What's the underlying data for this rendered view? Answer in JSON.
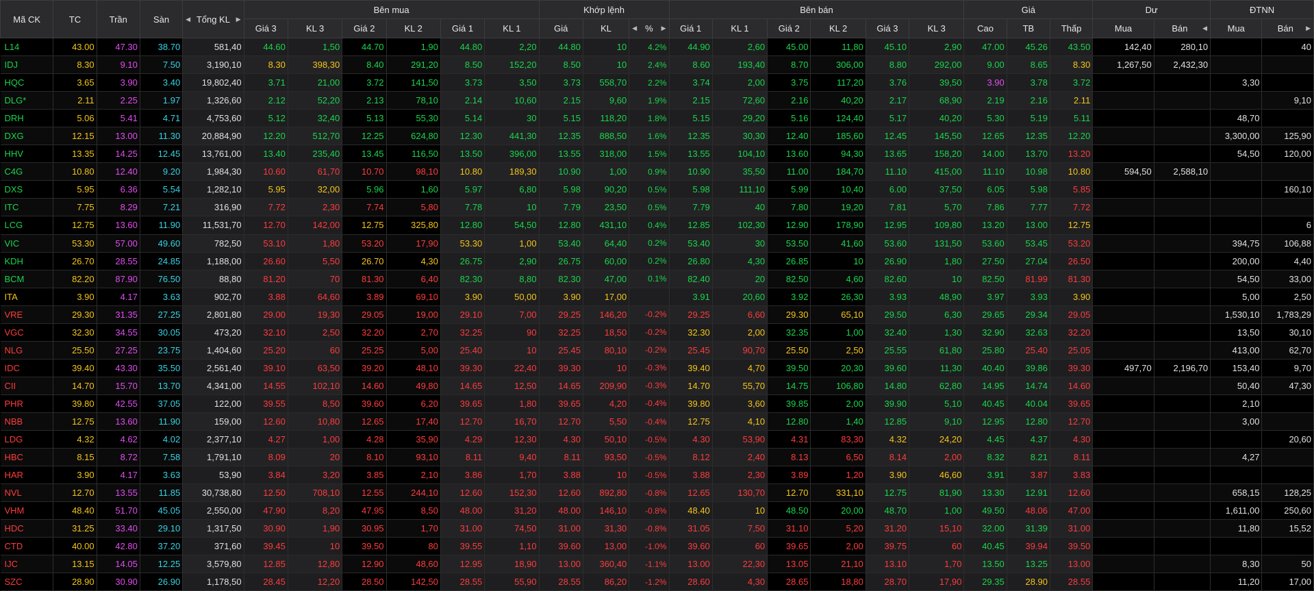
{
  "headers": {
    "symbol": "Mã CK",
    "ref": "TC",
    "ceil": "Trần",
    "floor": "Sàn",
    "total": "Tổng KL",
    "buy": "Bên mua",
    "match": "Khớp lệnh",
    "sell": "Bên bán",
    "price": "Giá",
    "remain": "Dư",
    "foreign": "ĐTNN",
    "price3": "Giá 3",
    "vol3": "KL 3",
    "price2": "Giá 2",
    "vol2": "KL 2",
    "price1": "Giá 1",
    "vol1": "KL 1",
    "matchPrice": "Giá",
    "matchVol": "KL",
    "pct": "%",
    "high": "Cao",
    "avg": "TB",
    "low": "Thấp",
    "remBuy": "Mua",
    "remSell": "Bán",
    "fBuy": "Mua",
    "fSell": "Bán"
  },
  "colors": {
    "up": "#19d54a",
    "down": "#ff3b3b",
    "ref": "#f5c518",
    "ceil": "#e34cf2",
    "floor": "#35d3e6"
  },
  "rows": [
    [
      "L14",
      "43.00",
      "47.30",
      "38.70",
      "581,40",
      "44.60",
      "1,50",
      "44.70",
      "1,90",
      "44.80",
      "2,20",
      "44.80",
      "10",
      "4.2%",
      "44.90",
      "2,60",
      "45.00",
      "11,80",
      "45.10",
      "2,90",
      "47.00",
      "45.26",
      "43.50",
      "142,40",
      "280,10",
      "",
      "40"
    ],
    [
      "IDJ",
      "8.30",
      "9.10",
      "7.50",
      "3,190,10",
      "8.30",
      "398,30",
      "8.40",
      "291,20",
      "8.50",
      "152,20",
      "8.50",
      "10",
      "2.4%",
      "8.60",
      "193,40",
      "8.70",
      "306,00",
      "8.80",
      "292,00",
      "9.00",
      "8.65",
      "8.30",
      "1,267,50",
      "2,432,30",
      "",
      ""
    ],
    [
      "HQC",
      "3.65",
      "3.90",
      "3.40",
      "19,802,40",
      "3.71",
      "21,00",
      "3.72",
      "141,50",
      "3.73",
      "3,50",
      "3.73",
      "558,70",
      "2.2%",
      "3.74",
      "2,00",
      "3.75",
      "117,20",
      "3.76",
      "39,50",
      "3.90",
      "3.78",
      "3.72",
      "",
      "",
      "3,30",
      ""
    ],
    [
      "DLG*",
      "2.11",
      "2.25",
      "1.97",
      "1,326,60",
      "2.12",
      "52,20",
      "2.13",
      "78,10",
      "2.14",
      "10,60",
      "2.15",
      "9,60",
      "1.9%",
      "2.15",
      "72,60",
      "2.16",
      "40,20",
      "2.17",
      "68,90",
      "2.19",
      "2.16",
      "2.11",
      "",
      "",
      "",
      "9,10"
    ],
    [
      "DRH",
      "5.06",
      "5.41",
      "4.71",
      "4,753,60",
      "5.12",
      "32,40",
      "5.13",
      "55,30",
      "5.14",
      "30",
      "5.15",
      "118,20",
      "1.8%",
      "5.15",
      "29,20",
      "5.16",
      "124,40",
      "5.17",
      "40,20",
      "5.30",
      "5.19",
      "5.11",
      "",
      "",
      "48,70",
      ""
    ],
    [
      "DXG",
      "12.15",
      "13.00",
      "11.30",
      "20,884,90",
      "12.20",
      "512,70",
      "12.25",
      "624,80",
      "12.30",
      "441,30",
      "12.35",
      "888,50",
      "1.6%",
      "12.35",
      "30,30",
      "12.40",
      "185,60",
      "12.45",
      "145,50",
      "12.65",
      "12.35",
      "12.20",
      "",
      "",
      "3,300,00",
      "125,90"
    ],
    [
      "HHV",
      "13.35",
      "14.25",
      "12.45",
      "13,761,00",
      "13.40",
      "235,40",
      "13.45",
      "116,50",
      "13.50",
      "396,00",
      "13.55",
      "318,00",
      "1.5%",
      "13.55",
      "104,10",
      "13.60",
      "94,30",
      "13.65",
      "158,20",
      "14.00",
      "13.70",
      "13.20",
      "",
      "",
      "54,50",
      "120,00"
    ],
    [
      "C4G",
      "10.80",
      "12.40",
      "9.20",
      "1,984,30",
      "10.60",
      "61,70",
      "10.70",
      "98,10",
      "10.80",
      "189,30",
      "10.90",
      "1,00",
      "0.9%",
      "10.90",
      "35,50",
      "11.00",
      "184,70",
      "11.10",
      "415,00",
      "11.10",
      "10.98",
      "10.80",
      "594,50",
      "2,588,10",
      "",
      ""
    ],
    [
      "DXS",
      "5.95",
      "6.36",
      "5.54",
      "1,282,10",
      "5.95",
      "32,00",
      "5.96",
      "1,60",
      "5.97",
      "6,80",
      "5.98",
      "90,20",
      "0.5%",
      "5.98",
      "111,10",
      "5.99",
      "10,40",
      "6.00",
      "37,50",
      "6.05",
      "5.98",
      "5.85",
      "",
      "",
      "",
      "160,10"
    ],
    [
      "ITC",
      "7.75",
      "8.29",
      "7.21",
      "316,90",
      "7.72",
      "2,30",
      "7.74",
      "5,80",
      "7.78",
      "10",
      "7.79",
      "23,50",
      "0.5%",
      "7.79",
      "40",
      "7.80",
      "19,20",
      "7.81",
      "5,70",
      "7.86",
      "7.77",
      "7.72",
      "",
      "",
      "",
      ""
    ],
    [
      "LCG",
      "12.75",
      "13.60",
      "11.90",
      "11,531,70",
      "12.70",
      "142,00",
      "12.75",
      "325,80",
      "12.80",
      "54,50",
      "12.80",
      "431,10",
      "0.4%",
      "12.85",
      "102,30",
      "12.90",
      "178,90",
      "12.95",
      "109,80",
      "13.20",
      "13.00",
      "12.75",
      "",
      "",
      "",
      "6"
    ],
    [
      "VIC",
      "53.30",
      "57.00",
      "49.60",
      "782,50",
      "53.10",
      "1,80",
      "53.20",
      "17,90",
      "53.30",
      "1,00",
      "53.40",
      "64,40",
      "0.2%",
      "53.40",
      "30",
      "53.50",
      "41,60",
      "53.60",
      "131,50",
      "53.60",
      "53.45",
      "53.20",
      "",
      "",
      "394,75",
      "106,88"
    ],
    [
      "KDH",
      "26.70",
      "28.55",
      "24.85",
      "1,188,00",
      "26.60",
      "5,50",
      "26.70",
      "4,30",
      "26.75",
      "2,90",
      "26.75",
      "60,00",
      "0.2%",
      "26.80",
      "4,30",
      "26.85",
      "10",
      "26.90",
      "1,80",
      "27.50",
      "27.04",
      "26.50",
      "",
      "",
      "200,00",
      "4,40"
    ],
    [
      "BCM",
      "82.20",
      "87.90",
      "76.50",
      "88,80",
      "81.20",
      "70",
      "81.30",
      "6,40",
      "82.30",
      "8,80",
      "82.30",
      "47,00",
      "0.1%",
      "82.40",
      "20",
      "82.50",
      "4,60",
      "82.60",
      "10",
      "82.50",
      "81.99",
      "81.30",
      "",
      "",
      "54,50",
      "33,00"
    ],
    [
      "ITA",
      "3.90",
      "4.17",
      "3.63",
      "902,70",
      "3.88",
      "64,60",
      "3.89",
      "69,10",
      "3.90",
      "50,00",
      "3.90",
      "17,00",
      "",
      "3.91",
      "20,60",
      "3.92",
      "26,30",
      "3.93",
      "48,90",
      "3.97",
      "3.93",
      "3.90",
      "",
      "",
      "5,00",
      "2,50"
    ],
    [
      "VRE",
      "29.30",
      "31.35",
      "27.25",
      "2,801,80",
      "29.00",
      "19,30",
      "29.05",
      "19,00",
      "29.10",
      "7,00",
      "29.25",
      "146,20",
      "-0.2%",
      "29.25",
      "6,60",
      "29.30",
      "65,10",
      "29.50",
      "6,30",
      "29.65",
      "29.34",
      "29.05",
      "",
      "",
      "1,530,10",
      "1,783,29"
    ],
    [
      "VGC",
      "32.30",
      "34.55",
      "30.05",
      "473,20",
      "32.10",
      "2,50",
      "32.20",
      "2,70",
      "32.25",
      "90",
      "32.25",
      "18,50",
      "-0.2%",
      "32.30",
      "2,00",
      "32.35",
      "1,00",
      "32.40",
      "1,30",
      "32.90",
      "32.63",
      "32.20",
      "",
      "",
      "13,50",
      "30,10"
    ],
    [
      "NLG",
      "25.50",
      "27.25",
      "23.75",
      "1,404,60",
      "25.20",
      "60",
      "25.25",
      "5,00",
      "25.40",
      "10",
      "25.45",
      "80,10",
      "-0.2%",
      "25.45",
      "90,70",
      "25.50",
      "2,50",
      "25.55",
      "61,80",
      "25.80",
      "25.40",
      "25.05",
      "",
      "",
      "413,00",
      "62,70"
    ],
    [
      "IDC",
      "39.40",
      "43.30",
      "35.50",
      "2,561,40",
      "39.10",
      "63,50",
      "39.20",
      "48,10",
      "39.30",
      "22,40",
      "39.30",
      "10",
      "-0.3%",
      "39.40",
      "4,70",
      "39.50",
      "20,30",
      "39.60",
      "11,30",
      "40.40",
      "39.86",
      "39.30",
      "497,70",
      "2,196,70",
      "153,40",
      "9,70"
    ],
    [
      "CII",
      "14.70",
      "15.70",
      "13.70",
      "4,341,00",
      "14.55",
      "102,10",
      "14.60",
      "49,80",
      "14.65",
      "12,50",
      "14.65",
      "209,90",
      "-0.3%",
      "14.70",
      "55,70",
      "14.75",
      "106,80",
      "14.80",
      "62,80",
      "14.95",
      "14.74",
      "14.60",
      "",
      "",
      "50,40",
      "47,30"
    ],
    [
      "PHR",
      "39.80",
      "42.55",
      "37.05",
      "122,00",
      "39.55",
      "8,50",
      "39.60",
      "6,20",
      "39.65",
      "1,80",
      "39.65",
      "4,20",
      "-0.4%",
      "39.80",
      "3,60",
      "39.85",
      "2,00",
      "39.90",
      "5,10",
      "40.45",
      "40.04",
      "39.65",
      "",
      "",
      "2,10",
      ""
    ],
    [
      "NBB",
      "12.75",
      "13.60",
      "11.90",
      "159,00",
      "12.60",
      "10,80",
      "12.65",
      "17,40",
      "12.70",
      "16,70",
      "12.70",
      "5,50",
      "-0.4%",
      "12.75",
      "4,10",
      "12.80",
      "1,40",
      "12.85",
      "9,10",
      "12.95",
      "12.80",
      "12.70",
      "",
      "",
      "3,00",
      ""
    ],
    [
      "LDG",
      "4.32",
      "4.62",
      "4.02",
      "2,377,10",
      "4.27",
      "1,00",
      "4.28",
      "35,90",
      "4.29",
      "12,30",
      "4.30",
      "50,10",
      "-0.5%",
      "4.30",
      "53,90",
      "4.31",
      "83,30",
      "4.32",
      "24,20",
      "4.45",
      "4.37",
      "4.30",
      "",
      "",
      "",
      "20,60"
    ],
    [
      "HBC",
      "8.15",
      "8.72",
      "7.58",
      "1,791,10",
      "8.09",
      "20",
      "8.10",
      "93,10",
      "8.11",
      "9,40",
      "8.11",
      "93,50",
      "-0.5%",
      "8.12",
      "2,40",
      "8.13",
      "6,50",
      "8.14",
      "2,00",
      "8.32",
      "8.21",
      "8.11",
      "",
      "",
      "4,27",
      ""
    ],
    [
      "HAR",
      "3.90",
      "4.17",
      "3.63",
      "53,90",
      "3.84",
      "3,20",
      "3.85",
      "2,10",
      "3.86",
      "1,70",
      "3.88",
      "10",
      "-0.5%",
      "3.88",
      "2,30",
      "3.89",
      "1,20",
      "3.90",
      "46,60",
      "3.91",
      "3.87",
      "3.83",
      "",
      "",
      "",
      ""
    ],
    [
      "NVL",
      "12.70",
      "13.55",
      "11.85",
      "30,738,80",
      "12.50",
      "708,10",
      "12.55",
      "244,10",
      "12.60",
      "152,30",
      "12.60",
      "892,80",
      "-0.8%",
      "12.65",
      "130,70",
      "12.70",
      "331,10",
      "12.75",
      "81,90",
      "13.30",
      "12.91",
      "12.60",
      "",
      "",
      "658,15",
      "128,25"
    ],
    [
      "VHM",
      "48.40",
      "51.70",
      "45.05",
      "2,550,00",
      "47.90",
      "8,20",
      "47.95",
      "8,50",
      "48.00",
      "31,20",
      "48.00",
      "146,10",
      "-0.8%",
      "48.40",
      "10",
      "48.50",
      "20,00",
      "48.70",
      "1,00",
      "49.50",
      "48.06",
      "47.00",
      "",
      "",
      "1,611,00",
      "250,60"
    ],
    [
      "HDC",
      "31.25",
      "33.40",
      "29.10",
      "1,317,50",
      "30.90",
      "1,90",
      "30.95",
      "1,70",
      "31.00",
      "74,50",
      "31.00",
      "31,30",
      "-0.8%",
      "31.05",
      "7,50",
      "31.10",
      "5,20",
      "31.20",
      "15,10",
      "32.00",
      "31.39",
      "31.00",
      "",
      "",
      "11,80",
      "15,52"
    ],
    [
      "CTD",
      "40.00",
      "42.80",
      "37.20",
      "371,60",
      "39.45",
      "10",
      "39.50",
      "80",
      "39.55",
      "1,10",
      "39.60",
      "13,00",
      "-1.0%",
      "39.60",
      "60",
      "39.65",
      "2,00",
      "39.75",
      "60",
      "40.45",
      "39.94",
      "39.50",
      "",
      "",
      "",
      ""
    ],
    [
      "IJC",
      "13.15",
      "14.05",
      "12.25",
      "3,579,80",
      "12.85",
      "12,80",
      "12.90",
      "48,60",
      "12.95",
      "18,90",
      "13.00",
      "360,40",
      "-1.1%",
      "13.00",
      "22,30",
      "13.05",
      "21,10",
      "13.10",
      "1,70",
      "13.50",
      "13.25",
      "13.00",
      "",
      "",
      "8,30",
      "50"
    ],
    [
      "SZC",
      "28.90",
      "30.90",
      "26.90",
      "1,178,50",
      "28.45",
      "12,20",
      "28.50",
      "142,50",
      "28.55",
      "55,90",
      "28.55",
      "86,20",
      "-1.2%",
      "28.60",
      "4,30",
      "28.65",
      "18,80",
      "28.70",
      "17,90",
      "29.35",
      "28.90",
      "28.55",
      "",
      "",
      "11,20",
      "17,00"
    ]
  ]
}
